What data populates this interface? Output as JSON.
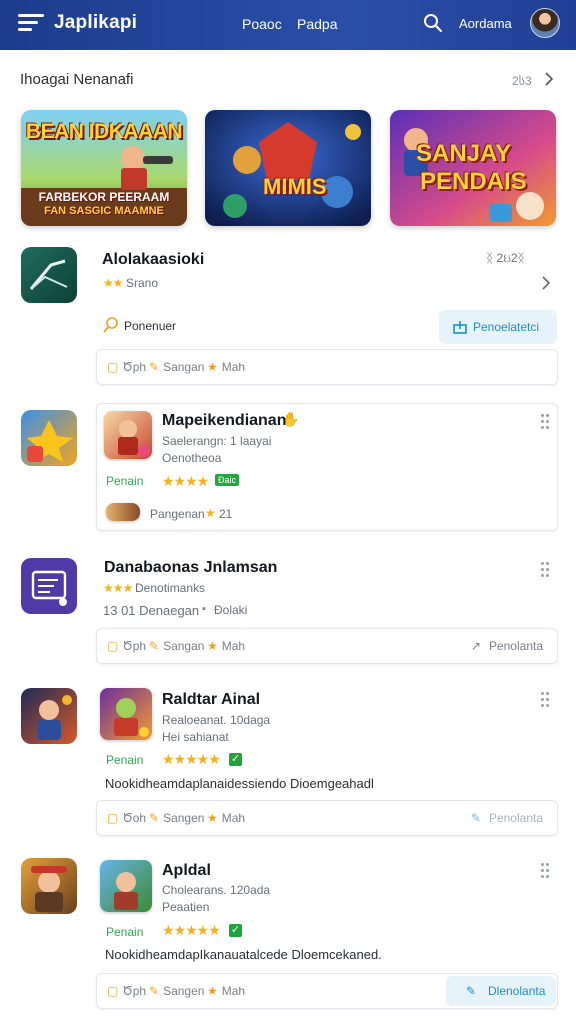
{
  "header": {
    "title": "Japlikapi",
    "nav": [
      "Poaoc",
      "Padpa"
    ],
    "account": "Aordama"
  },
  "section": {
    "title": "Ihoagai Nenanafi",
    "count": "2ს3"
  },
  "banners": [
    {
      "line1": "BEAN IDKAAAN",
      "line2": "FARBEKOR PEERAAM",
      "line3": "FAN SASGIC MAAMNE"
    },
    {
      "big": "MIMIS"
    },
    {
      "line1": "SANJAY",
      "line2": "PENDAIS"
    }
  ],
  "apps": [
    {
      "name": "Alolakaasioki",
      "rating_text": "Srano",
      "top_right": "ᛝ 2ઇ2ᛝ",
      "note": "Ponenuer",
      "button": "Penoelatetci",
      "actions": [
        "Ծph",
        "Sangan",
        "Mah"
      ]
    },
    {
      "inner_title": "Mapeikendianan",
      "inner_sub1": "Saelerangn: 1 Ɩaayai",
      "inner_sub2": "Oenotheoa",
      "label": "Penain",
      "badge": "Ɖaic",
      "footer": "Pangenan",
      "footer_num": "21"
    },
    {
      "name": "Danabaonas Jnlamsan",
      "rating_text": "Denotimanks",
      "meta": "13 01 Denaegan",
      "meta2": "Ɖolaki",
      "actions": [
        "Ծph",
        "Sangan",
        "Mah"
      ],
      "right_action": "Penolanta"
    },
    {
      "inner_title": "Raldtar Ainal",
      "inner_sub1": "Realoeanat. 10daga",
      "inner_sub2": "Hei sahianat",
      "label": "Penain",
      "desc": "Nookidheamdaplanaidessiendo Dioemgeahadl",
      "actions": [
        "Ծoh",
        "Sangen",
        "Mah"
      ],
      "right_action": "Penolanta"
    },
    {
      "inner_title": "Apldal",
      "inner_sub1": "Cholearans. 120ada",
      "inner_sub2": "Peaatien",
      "label": "Penain",
      "desc": "NookidheamdapIkanauatalcede Dloemcekaned.",
      "actions": [
        "Ծph",
        "Sangen",
        "Mah"
      ],
      "right_action": "Dlenolanta"
    }
  ],
  "colors": {
    "header": "#1d3c8c",
    "accent": "#1b90c9",
    "star": "#f3b21b",
    "green": "#2fa84f"
  }
}
